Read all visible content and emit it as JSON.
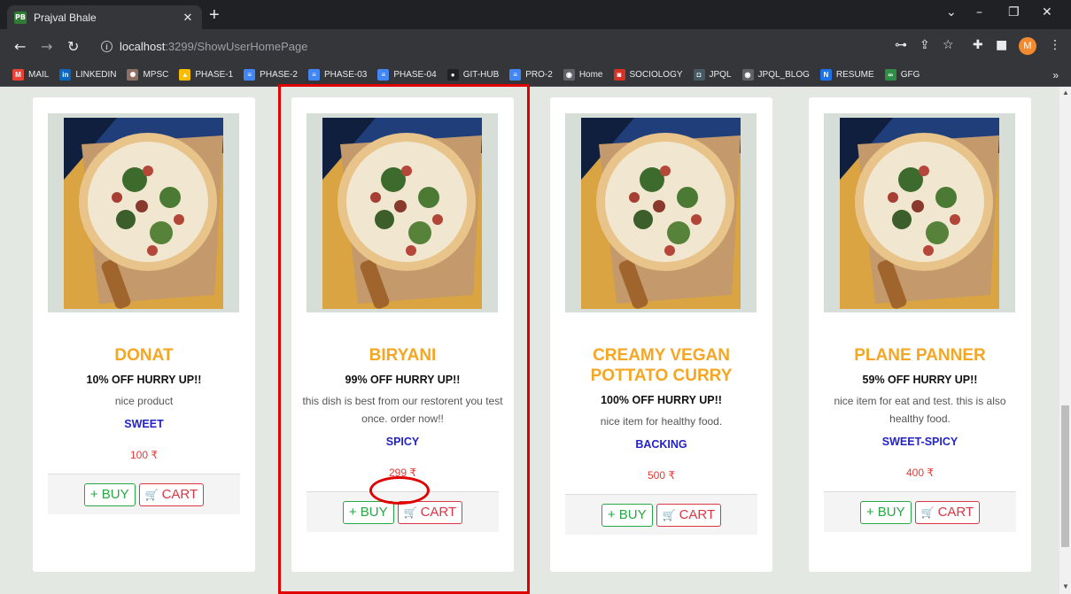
{
  "browser": {
    "tab_title": "Prajval Bhale",
    "tab_favicon": "PB",
    "url_host": "localhost",
    "url_path": ":3299/ShowUserHomePage",
    "profile_initial": "M"
  },
  "bookmarks": [
    {
      "label": "MAIL",
      "icon": "gmail-icon",
      "color": "#ea4335",
      "glyph": "M"
    },
    {
      "label": "LINKEDIN",
      "icon": "linkedin-icon",
      "color": "#0a66c2",
      "glyph": "in"
    },
    {
      "label": "MPSC",
      "icon": "mpsc-icon",
      "color": "#8d6e63",
      "glyph": "✺"
    },
    {
      "label": "PHASE-1",
      "icon": "drive-icon",
      "color": "#fbbc04",
      "glyph": "▲"
    },
    {
      "label": "PHASE-2",
      "icon": "docs-icon",
      "color": "#4285f4",
      "glyph": "≡"
    },
    {
      "label": "PHASE-03",
      "icon": "docs-icon",
      "color": "#4285f4",
      "glyph": "≡"
    },
    {
      "label": "PHASE-04",
      "icon": "docs-icon",
      "color": "#4285f4",
      "glyph": "≡"
    },
    {
      "label": "GIT-HUB",
      "icon": "github-icon",
      "color": "#202124",
      "glyph": "●"
    },
    {
      "label": "PRO-2",
      "icon": "docs-icon",
      "color": "#4285f4",
      "glyph": "≡"
    },
    {
      "label": "Home",
      "icon": "globe-icon",
      "color": "#5f6368",
      "glyph": "◉"
    },
    {
      "label": "SOCIOLOGY",
      "icon": "sociology-icon",
      "color": "#d93025",
      "glyph": "◙"
    },
    {
      "label": "JPQL",
      "icon": "jpql-icon",
      "color": "#455a64",
      "glyph": "◘"
    },
    {
      "label": "JPQL_BLOG",
      "icon": "globe-icon",
      "color": "#5f6368",
      "glyph": "◉"
    },
    {
      "label": "RESUME",
      "icon": "resume-icon",
      "color": "#1a73e8",
      "glyph": "N"
    },
    {
      "label": "GFG",
      "icon": "gfg-icon",
      "color": "#2f8d46",
      "glyph": "∞"
    }
  ],
  "products": [
    {
      "name": "DONAT",
      "offer": "10% OFF HURRY UP!!",
      "description": "nice product",
      "category": "SWEET",
      "price": "100 ₹"
    },
    {
      "name": "BIRYANI",
      "offer": "99% OFF HURRY UP!!",
      "description": "this dish is best from our restorent you test once. order now!!",
      "category": "SPICY",
      "price": "299 ₹"
    },
    {
      "name": "CREAMY VEGAN POTTATO CURRY",
      "offer": "100% OFF HURRY UP!!",
      "description": "nice item for healthy food.",
      "category": "BACKING",
      "price": "500 ₹"
    },
    {
      "name": "PLANE PANNER",
      "offer": "59% OFF HURRY UP!!",
      "description": "nice item for eat and test. this is also healthy food.",
      "category": "SWEET-SPICY",
      "price": "400 ₹"
    }
  ],
  "labels": {
    "buy": "+ BUY",
    "cart": "CART",
    "cart_glyph": "🛒"
  },
  "colors": {
    "name": "#f5a623",
    "category": "#2323c8",
    "price": "#e53935",
    "buy": "#28a745",
    "cart": "#dc3545",
    "highlight": "#e00000"
  }
}
